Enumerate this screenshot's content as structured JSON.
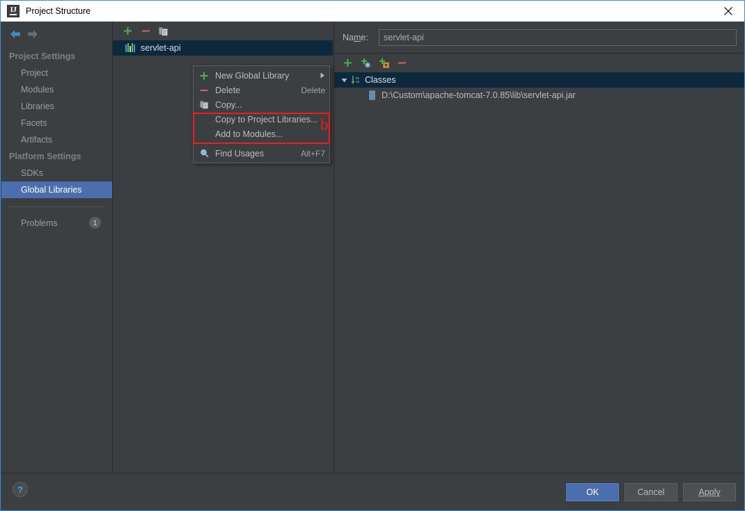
{
  "window": {
    "title": "Project Structure",
    "app_icon": "intellij-idea-icon",
    "close_icon": "close-icon"
  },
  "sidebar": {
    "nav": {
      "back_icon": "back-arrow-icon",
      "forward_icon": "forward-arrow-icon"
    },
    "groups": [
      {
        "label": "Project Settings",
        "items": [
          {
            "label": "Project",
            "selected": false
          },
          {
            "label": "Modules",
            "selected": false
          },
          {
            "label": "Libraries",
            "selected": false
          },
          {
            "label": "Facets",
            "selected": false
          },
          {
            "label": "Artifacts",
            "selected": false
          }
        ]
      },
      {
        "label": "Platform Settings",
        "items": [
          {
            "label": "SDKs",
            "selected": false
          },
          {
            "label": "Global Libraries",
            "selected": true
          }
        ]
      }
    ],
    "problems": {
      "label": "Problems",
      "count": "1"
    }
  },
  "library_panel": {
    "toolbar": [
      {
        "name": "add-library-button",
        "icon": "plus-icon"
      },
      {
        "name": "remove-library-button",
        "icon": "minus-icon"
      },
      {
        "name": "copy-library-button",
        "icon": "copy-icon"
      }
    ],
    "items": [
      {
        "label": "servlet-api",
        "icon": "library-bars-icon",
        "selected": true
      }
    ]
  },
  "context_menu": {
    "items": [
      {
        "label": "New Global Library",
        "icon": "plus-icon",
        "accel": "",
        "submenu": true,
        "name": "menu-new-global-library"
      },
      {
        "label": "Delete",
        "icon": "minus-icon",
        "accel": "Delete",
        "submenu": false,
        "name": "menu-delete"
      },
      {
        "label": "Copy...",
        "icon": "copy-icon",
        "accel": "",
        "submenu": false,
        "name": "menu-copy"
      },
      {
        "label": "Copy to Project Libraries...",
        "icon": "",
        "accel": "",
        "submenu": false,
        "name": "menu-copy-to-project-libraries"
      },
      {
        "label": "Add to Modules...",
        "icon": "",
        "accel": "",
        "submenu": false,
        "name": "menu-add-to-modules"
      },
      {
        "label": "Find Usages",
        "icon": "search-icon",
        "accel": "Alt+F7",
        "submenu": false,
        "name": "menu-find-usages"
      }
    ],
    "annotation": {
      "letter": "b",
      "color": "#f41b1b"
    }
  },
  "detail": {
    "name_label_pre": "Na",
    "name_label_mnemonic": "m",
    "name_label_post": "e:",
    "name_value": "servlet-api",
    "roots_toolbar": [
      {
        "name": "add-root-button",
        "icon": "plus-icon"
      },
      {
        "name": "add-url-root-button",
        "icon": "plus-globe-icon"
      },
      {
        "name": "add-jar-directory-button",
        "icon": "plus-jar-icon"
      },
      {
        "name": "remove-root-button",
        "icon": "minus-icon"
      }
    ],
    "tree": {
      "root": {
        "label": "Classes",
        "icon": "classes-order-icon",
        "expanded": true,
        "selected": true
      },
      "children": [
        {
          "label": "D:\\Custom\\apache-tomcat-7.0.85\\lib\\servlet-api.jar",
          "icon": "jar-file-icon"
        }
      ]
    }
  },
  "footer": {
    "help_icon": "help-icon",
    "buttons": [
      {
        "name": "ok-button",
        "label": "OK",
        "primary": true
      },
      {
        "name": "cancel-button",
        "label": "Cancel",
        "primary": false
      },
      {
        "name": "apply-button",
        "label": "Apply",
        "primary": false,
        "mnemonic": "A"
      }
    ]
  },
  "colors": {
    "accent": "#4b6eaf",
    "selection": "#0d293e",
    "annotation": "#f41b1b",
    "panel": "#3c3f41"
  }
}
